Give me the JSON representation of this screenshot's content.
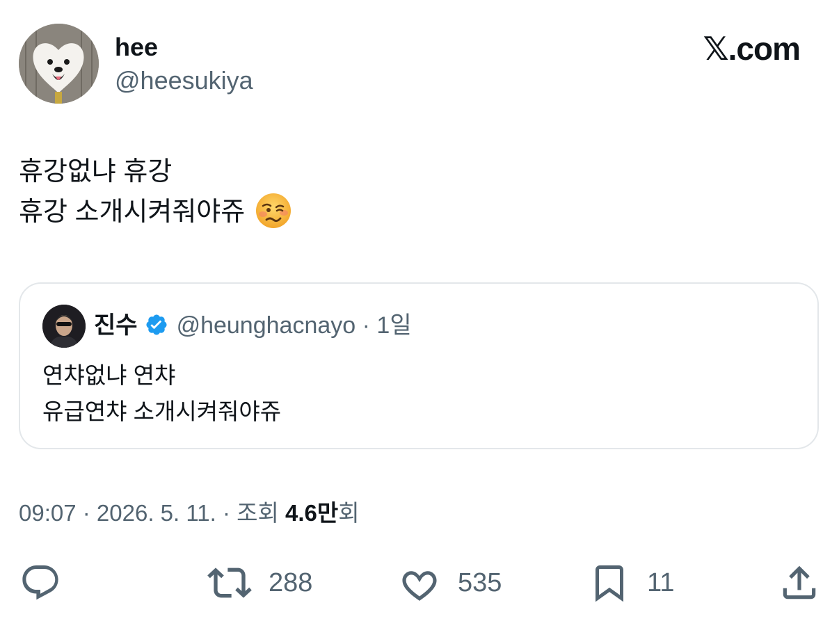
{
  "author": {
    "display_name": "hee",
    "handle": "@heesukiya",
    "avatar_icon": "dog-avatar"
  },
  "brand": {
    "mark": "𝕏",
    "text": ".com"
  },
  "tweet": {
    "lines": [
      "휴강없냐 휴강",
      "휴강 소개시켜줘야쥬"
    ],
    "emoji": "woozy-face-icon"
  },
  "quote": {
    "name": "진수",
    "handle": "@heunghacnayo",
    "separator": "·",
    "time": "1일",
    "lines": [
      "연챠없냐 연챠",
      "유급연챠 소개시켜줘야쥬"
    ],
    "verified_color": "#1d9bf0"
  },
  "meta": {
    "time": "09:07",
    "sep1": " · ",
    "date": "2026. 5. 11.",
    "sep2": " · ",
    "views_label": "조회 ",
    "views_count": "4.6만",
    "views_suffix": "회"
  },
  "actions": {
    "reply": {
      "icon": "reply-icon",
      "count": ""
    },
    "retweet": {
      "icon": "retweet-icon",
      "count": "288"
    },
    "like": {
      "icon": "heart-icon",
      "count": "535"
    },
    "bookmark": {
      "icon": "bookmark-icon",
      "count": "11"
    },
    "share": {
      "icon": "share-icon",
      "count": ""
    }
  },
  "colors": {
    "text_primary": "#0f1419",
    "text_secondary": "#536471",
    "border": "#e3e7ea",
    "accent": "#1d9bf0"
  }
}
